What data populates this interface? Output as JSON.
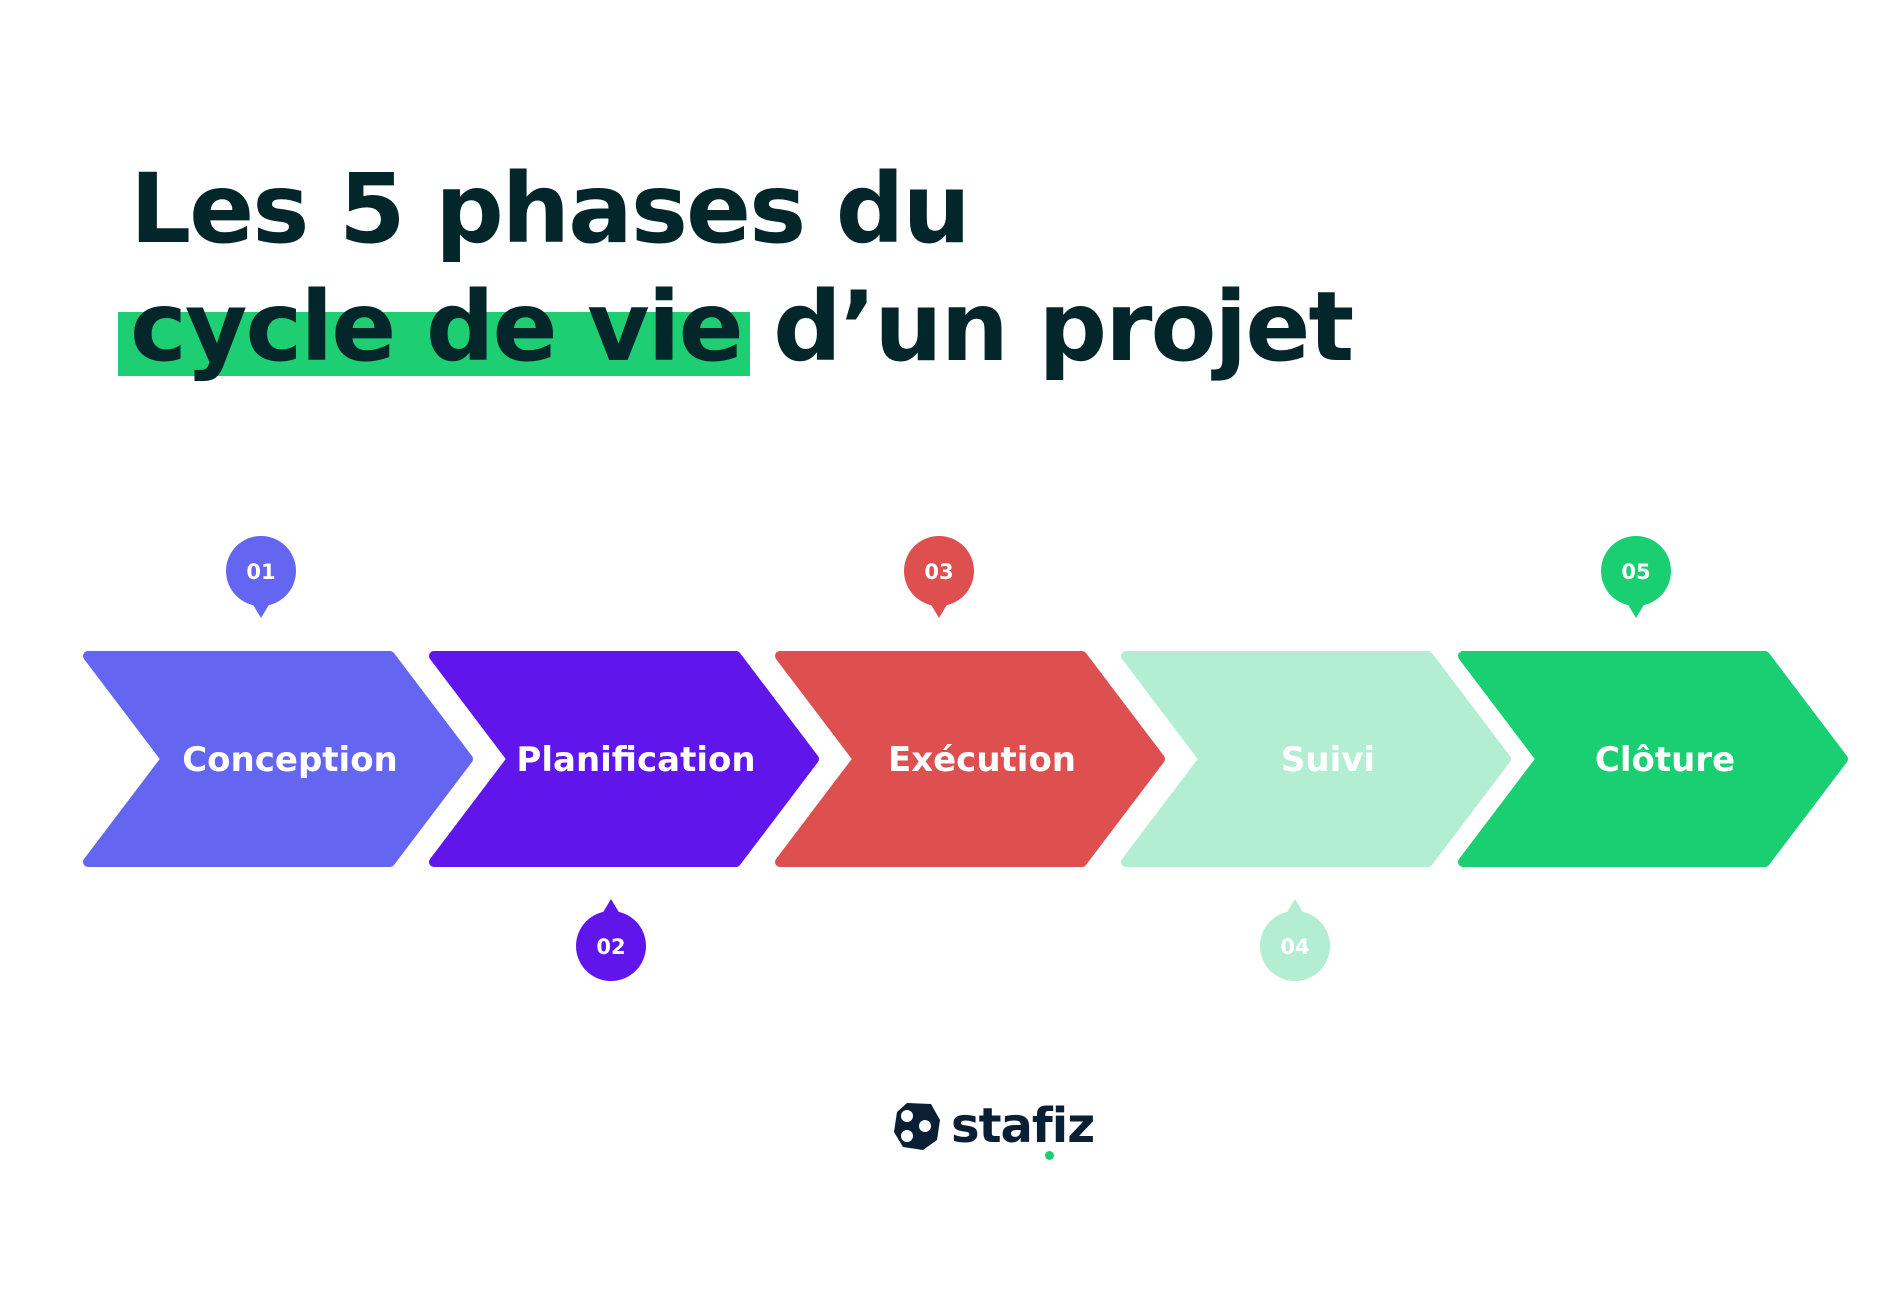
{
  "title": {
    "line1": "Les 5 phases du",
    "line2_highlight": "cycle de vie",
    "line2_rest": " d’un projet",
    "color": "#03262b",
    "highlight_color": "#1dce72"
  },
  "phases": [
    {
      "number": "01",
      "label": "Conception",
      "color": "#6466f1",
      "bubble": "top"
    },
    {
      "number": "02",
      "label": "Planification",
      "color": "#6016eb",
      "bubble": "bottom"
    },
    {
      "number": "03",
      "label": "Exécution",
      "color": "#de4f4f",
      "bubble": "top"
    },
    {
      "number": "04",
      "label": "Suivi",
      "color": "#b3edd2",
      "bubble": "bottom"
    },
    {
      "number": "05",
      "label": "Clôture",
      "color": "#1ace72",
      "bubble": "top"
    }
  ],
  "logo": {
    "text": "stafiz",
    "color": "#0a1f33",
    "accent": "#1dce72"
  }
}
